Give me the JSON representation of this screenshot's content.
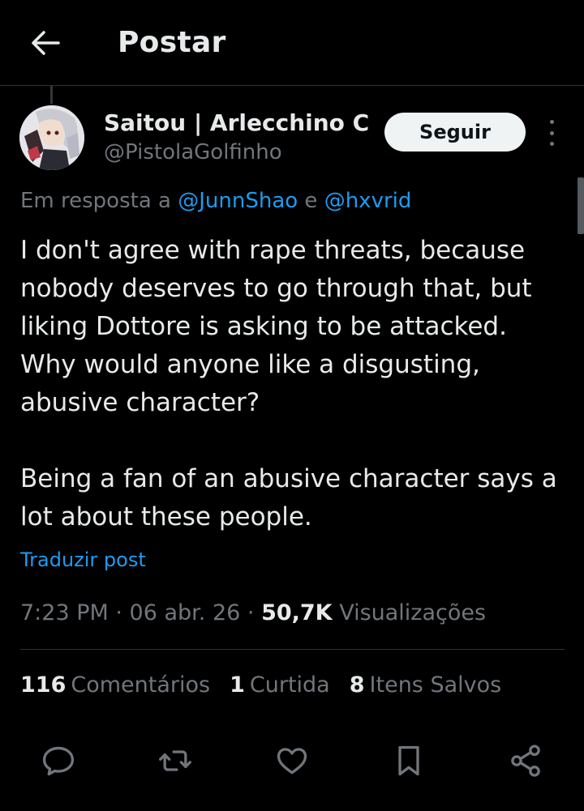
{
  "header": {
    "title": "Postar",
    "back_icon": "arrow-left-icon"
  },
  "author": {
    "display_name": "Saitou | Arlecchino C...",
    "handle": "@PistolaGolfinho",
    "follow_label": "Seguir",
    "more_icon": "more-vertical-icon"
  },
  "reply": {
    "prefix": "Em resposta a ",
    "mention1": "@JunnShao",
    "joiner": " e ",
    "mention2": "@hxvrid"
  },
  "post": {
    "text": "I don't agree with rape threats, because nobody deserves to go through that, but liking Dottore is asking to be attacked. Why would anyone like a disgusting, abusive character?\n\nBeing a fan of an abusive character says a lot about these people.",
    "translate_label": "Traduzir post"
  },
  "meta": {
    "time_date": "7:23 PM · 06 abr. 26 · ",
    "views_count": "50,7K",
    "views_label": " Visualizações"
  },
  "stats": {
    "comments_count": "116",
    "comments_label": "Comentários",
    "likes_count": "1",
    "likes_label": "Curtida",
    "saves_count": "8",
    "saves_label": "Itens Salvos"
  },
  "actions": [
    "reply-icon",
    "repost-icon",
    "like-icon",
    "bookmark-icon",
    "share-icon"
  ],
  "colors": {
    "background": "#000000",
    "text": "#e7e9ea",
    "secondary_text": "#71767b",
    "link": "#1d9bf0",
    "follow_button_bg": "#eff3f4",
    "divider": "#2f3336"
  }
}
